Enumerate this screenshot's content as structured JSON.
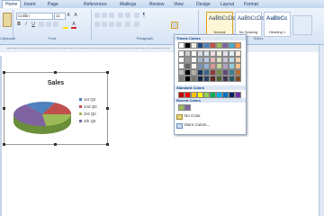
{
  "tabs": [
    "Home",
    "Insert",
    "Page Layout",
    "References",
    "Mailings",
    "Review",
    "View",
    "Design",
    "Layout",
    "Format"
  ],
  "ribbon": {
    "font_name": "Calibri",
    "font_size": "11",
    "groups": [
      "Clipboard",
      "Font",
      "Paragraph",
      "Styles"
    ],
    "styles": [
      {
        "sample": "AaBbCcDc",
        "name": "Normal"
      },
      {
        "sample": "AaBbCcDc",
        "name": "No Spacing"
      },
      {
        "sample": "AaBbCc",
        "name": "Heading 1"
      }
    ]
  },
  "chart": {
    "title": "Sales",
    "legend": [
      "1st Qtr",
      "2nd Qtr",
      "3rd Qtr",
      "4th Qtr"
    ],
    "colors": [
      "#4f81bd",
      "#c0504d",
      "#9bbb59",
      "#8064a2"
    ]
  },
  "dropdown": {
    "theme_label": "Theme Colors",
    "standard_label": "Standard Colors",
    "recent_label": "Recent Colors",
    "no_color": "No Color",
    "more_colors": "More Colors..."
  }
}
